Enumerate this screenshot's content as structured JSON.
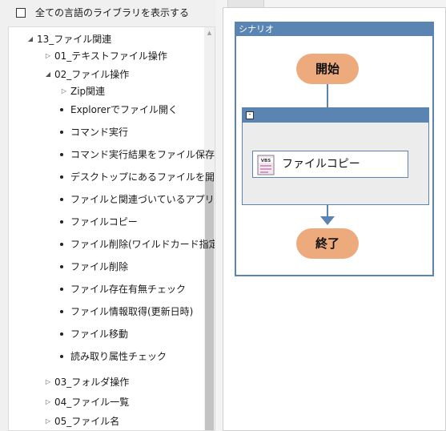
{
  "left_panel": {
    "show_all_label": "全ての言語のライブラリを表示する",
    "show_all_checked": false
  },
  "tree": {
    "items": [
      {
        "label": "13_ファイル関連",
        "kind": "expanded"
      },
      {
        "label": "01_テキストファイル操作",
        "kind": "collapsed"
      },
      {
        "label": "02_ファイル操作",
        "kind": "expanded"
      },
      {
        "label": "Zip関連",
        "kind": "collapsed"
      },
      {
        "label": "Explorerでファイル開く",
        "kind": "leaf"
      },
      {
        "label": "コマンド実行",
        "kind": "leaf"
      },
      {
        "label": "コマンド実行結果をファイル保存",
        "kind": "leaf"
      },
      {
        "label": "デスクトップにあるファイルを開く",
        "kind": "leaf"
      },
      {
        "label": "ファイルと関連づいているアプリ起動",
        "kind": "leaf"
      },
      {
        "label": "ファイルコピー",
        "kind": "leaf"
      },
      {
        "label": "ファイル削除(ワイルドカード指定)",
        "kind": "leaf"
      },
      {
        "label": "ファイル削除",
        "kind": "leaf"
      },
      {
        "label": "ファイル存在有無チェック",
        "kind": "leaf"
      },
      {
        "label": "ファイル情報取得(更新日時)",
        "kind": "leaf"
      },
      {
        "label": "ファイル移動",
        "kind": "leaf"
      },
      {
        "label": "読み取り属性チェック",
        "kind": "leaf"
      },
      {
        "label": "03_フォルダ操作",
        "kind": "collapsed"
      },
      {
        "label": "04_ファイル一覧",
        "kind": "collapsed"
      },
      {
        "label": "05_ファイル名",
        "kind": "collapsed"
      }
    ]
  },
  "scenario": {
    "title": "シナリオ",
    "start_label": "開始",
    "end_label": "終了",
    "group_collapse_symbol": "-",
    "action_label": "ファイルコピー",
    "action_icon": "vbs-script-icon",
    "action_icon_text": "VBS"
  },
  "colors": {
    "accent": "#5a84b1",
    "node_fill": "#edab7d",
    "group_fill": "#ececec"
  }
}
